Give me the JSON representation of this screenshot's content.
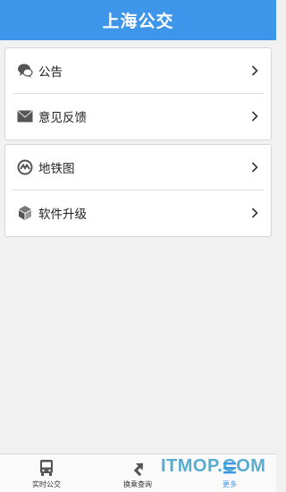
{
  "header": {
    "title": "上海公交"
  },
  "menu": {
    "group1": [
      {
        "label": "公告",
        "icon": "speech-bubbles-icon"
      },
      {
        "label": "意见反馈",
        "icon": "envelope-icon"
      }
    ],
    "group2": [
      {
        "label": "地铁图",
        "icon": "metro-logo-icon"
      },
      {
        "label": "软件升级",
        "icon": "upgrade-box-icon"
      }
    ]
  },
  "tabbar": {
    "tabs": [
      {
        "label": "实时公交",
        "icon": "bus-icon",
        "active": false
      },
      {
        "label": "换乘查询",
        "icon": "transfer-arrow-icon",
        "active": false
      },
      {
        "label": "更多",
        "icon": "more-icon",
        "active": true
      }
    ]
  },
  "watermark": "ITMOP.COM",
  "colors": {
    "primary": "#3d96ea",
    "background": "#f1f1f1"
  }
}
